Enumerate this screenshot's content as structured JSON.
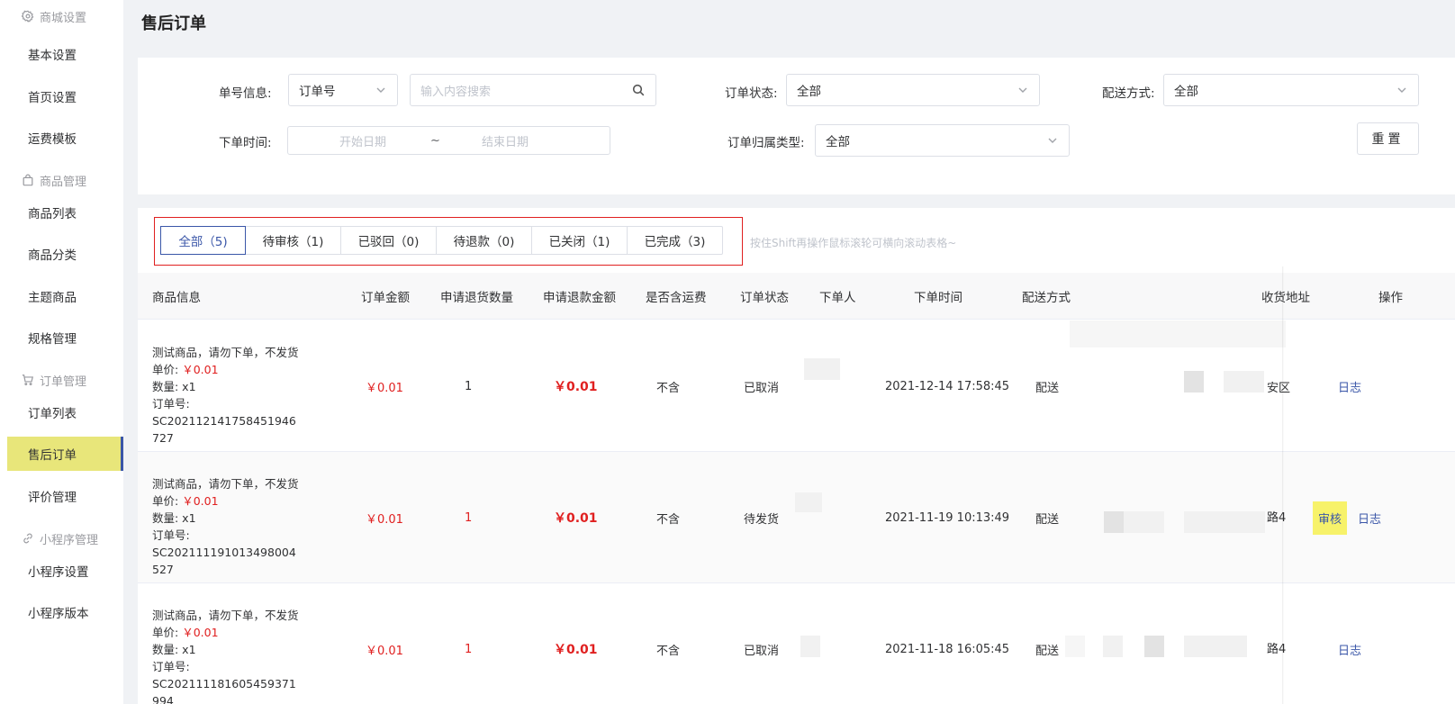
{
  "sidebar": {
    "groups": {
      "mall": "商城设置",
      "goods": "商品管理",
      "orders": "订单管理",
      "mini": "小程序管理"
    },
    "items": {
      "basic": "基本设置",
      "home": "首页设置",
      "freight": "运费模板",
      "goods_list": "商品列表",
      "goods_cat": "商品分类",
      "theme_goods": "主题商品",
      "spec": "规格管理",
      "order_list": "订单列表",
      "aftersale": "售后订单",
      "review": "评价管理",
      "mini_settings": "小程序设置",
      "mini_version": "小程序版本"
    }
  },
  "page": {
    "title": "售后订单"
  },
  "filters": {
    "order_info_label": "单号信息:",
    "order_info_type": "订单号",
    "search_placeholder": "输入内容搜索",
    "order_status_label": "订单状态:",
    "order_status_value": "全部",
    "delivery_label": "配送方式:",
    "delivery_value": "全部",
    "order_time_label": "下单时间:",
    "start_date": "开始日期",
    "date_sep": "~",
    "end_date": "结束日期",
    "belong_label": "订单归属类型:",
    "belong_value": "全部",
    "reset": "重置"
  },
  "tabs": [
    {
      "label": "全部（5)"
    },
    {
      "label": "待审核（1)"
    },
    {
      "label": "已驳回（0)"
    },
    {
      "label": "待退款（0)"
    },
    {
      "label": "已关闭（1)"
    },
    {
      "label": "已完成（3)"
    }
  ],
  "hint": "按住Shift再操作鼠标滚轮可横向滚动表格~",
  "table": {
    "headers": {
      "goods": "商品信息",
      "amount": "订单金额",
      "qty": "申请退货数量",
      "refund": "申请退款金额",
      "freight": "是否含运费",
      "status": "订单状态",
      "buyer": "下单人",
      "time": "下单时间",
      "delivery": "配送方式",
      "address": "收货地址",
      "ops": "操作"
    },
    "rows": [
      {
        "name": "测试商品，请勿下单，不发货",
        "unit_label": "单价:",
        "unit_price": "￥0.01",
        "qty_label": "数量: x1",
        "order_no_1": "订单号: SC202112141758451946",
        "order_no_2": "727",
        "amount": "￥0.01",
        "qty": "1",
        "refund": "￥0.01",
        "freight": "不含",
        "status": "已取消",
        "time": "2021-12-14 17:58:45",
        "delivery": "配送",
        "addr_tail": "安区",
        "log": "日志"
      },
      {
        "name": "测试商品，请勿下单，不发货",
        "unit_label": "单价:",
        "unit_price": "￥0.01",
        "qty_label": "数量: x1",
        "order_no_1": "订单号: SC202111191013498004",
        "order_no_2": "527",
        "amount": "￥0.01",
        "qty": "1",
        "refund": "￥0.01",
        "freight": "不含",
        "status": "待发货",
        "time": "2021-11-19 10:13:49",
        "delivery": "配送",
        "addr_tail": "路4",
        "audit": "审核",
        "log": "日志"
      },
      {
        "name": "测试商品，请勿下单，不发货",
        "unit_label": "单价:",
        "unit_price": "￥0.01",
        "qty_label": "数量: x1",
        "order_no_1": "订单号: SC202111181605459371",
        "order_no_2": "994",
        "amount": "￥0.01",
        "qty": "1",
        "refund": "￥0.01",
        "freight": "不含",
        "status": "已取消",
        "time": "2021-11-18 16:05:45",
        "delivery": "配送",
        "addr_tail": "路4",
        "log": "日志"
      }
    ]
  }
}
